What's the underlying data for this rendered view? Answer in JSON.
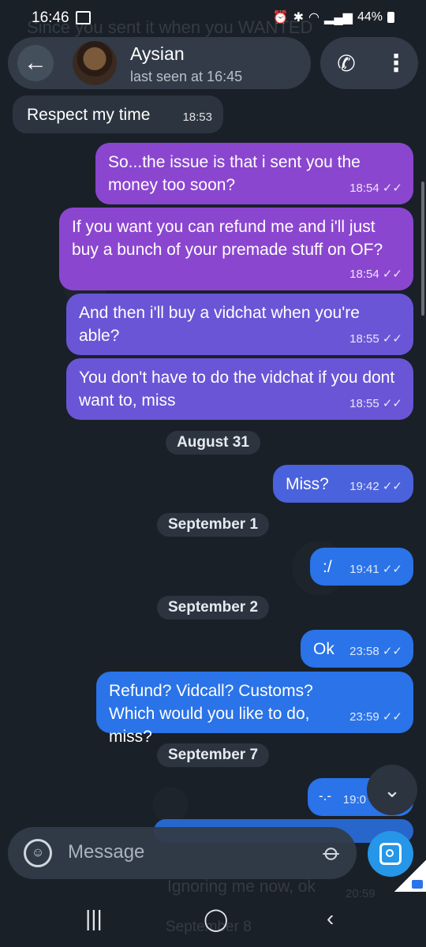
{
  "status_bar": {
    "time": "16:46",
    "battery": "44%"
  },
  "background_ghost_text": {
    "line1": "Since you sent it when you WANTED",
    "line2": "Ignoring me now, ok",
    "line2_time": "20:59",
    "date": "September 8"
  },
  "header": {
    "contact_name": "Aysian",
    "last_seen": "last seen at 16:45"
  },
  "messages": [
    {
      "direction": "in",
      "text": "Respect my time",
      "time": "18:53"
    },
    {
      "direction": "out",
      "text": "So...the issue is that i sent you the money too soon?",
      "time": "18:54",
      "read": "✓✓"
    },
    {
      "direction": "out",
      "text": "If you want you can refund me and i'll just buy a bunch of your premade stuff on OF?",
      "time": "18:54",
      "read": "✓✓"
    },
    {
      "direction": "out",
      "text": "And then i'll buy a vidchat when you're able?",
      "time": "18:55",
      "read": "✓✓"
    },
    {
      "direction": "out",
      "text": "You don't have to do the vidchat if you dont want to, miss",
      "time": "18:55",
      "read": "✓✓"
    },
    {
      "date": "August 31"
    },
    {
      "direction": "out",
      "text": "Miss?",
      "time": "19:42",
      "read": "✓✓"
    },
    {
      "date": "September 1"
    },
    {
      "direction": "out",
      "text": ":/",
      "time": "19:41",
      "read": "✓✓"
    },
    {
      "date": "September 2"
    },
    {
      "direction": "out",
      "text": "Ok",
      "time": "23:58",
      "read": "✓✓"
    },
    {
      "direction": "out",
      "text": "Refund? Vidcall? Customs? Which would you like to do, miss?",
      "time": "23:59",
      "read": "✓✓"
    },
    {
      "date": "September 7"
    },
    {
      "direction": "out",
      "text": "-.-",
      "time": "19:0"
    }
  ],
  "input": {
    "placeholder": "Message"
  },
  "icons": {
    "back": "arrow-left-icon",
    "phone": "phone-icon",
    "more": "more-vertical-icon",
    "emoji": "emoji-icon",
    "attach": "paperclip-icon",
    "camera": "camera-icon",
    "scroll_down": "chevron-down-icon"
  },
  "colors": {
    "background": "#1a2028",
    "incoming_bubble": "#2c3440",
    "outgoing_purple": "#8b46d0",
    "outgoing_indigo": "#6a55d6",
    "outgoing_blue": "#2a73e8",
    "accent": "#2596e8"
  }
}
